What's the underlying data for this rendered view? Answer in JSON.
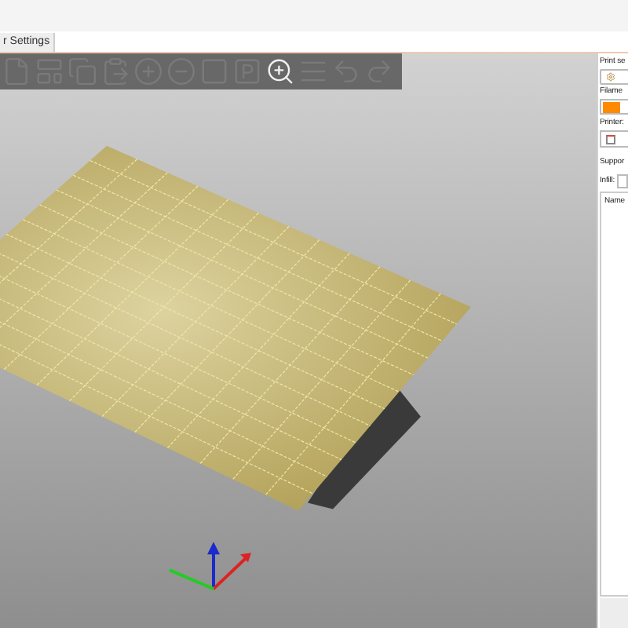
{
  "tabs": [
    {
      "label": "r Settings",
      "selected": true
    }
  ],
  "toolbar": {
    "tools": [
      {
        "kind": "doc"
      },
      {
        "kind": "layout"
      },
      {
        "kind": "copy"
      },
      {
        "kind": "paste"
      },
      {
        "kind": "plus"
      },
      {
        "kind": "minus"
      },
      {
        "kind": "split"
      },
      {
        "kind": "part"
      },
      {
        "kind": "search",
        "selected": true
      },
      {
        "kind": "layers"
      },
      {
        "kind": "undo"
      },
      {
        "kind": "redo"
      }
    ]
  },
  "sidebar": {
    "print_settings_label": "Print se",
    "filament_label": "Filame",
    "printer_label": "Printer:",
    "supports_label": "Suppor",
    "infill_label": "Infill:",
    "objects_list": {
      "columns": [
        "Name"
      ]
    }
  }
}
